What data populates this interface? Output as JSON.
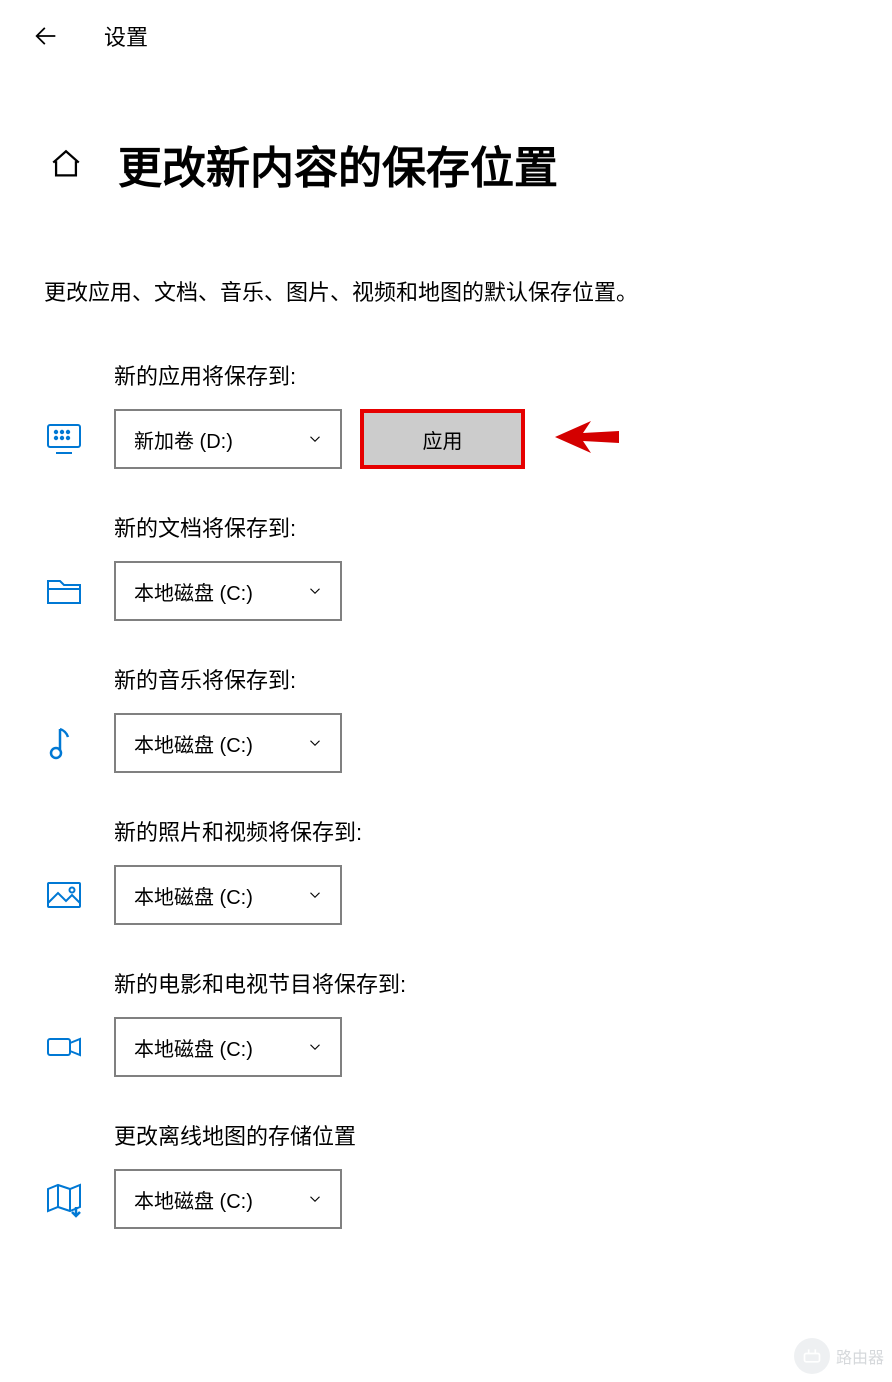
{
  "topbar": {
    "title": "设置"
  },
  "page": {
    "title": "更改新内容的保存位置",
    "description": "更改应用、文档、音乐、图片、视频和地图的默认保存位置。"
  },
  "settings": {
    "apps": {
      "label": "新的应用将保存到:",
      "value": "新加卷 (D:)",
      "apply": "应用",
      "icon": "keyboard-monitor-icon"
    },
    "documents": {
      "label": "新的文档将保存到:",
      "value": "本地磁盘 (C:)",
      "icon": "folder-icon"
    },
    "music": {
      "label": "新的音乐将保存到:",
      "value": "本地磁盘 (C:)",
      "icon": "music-note-icon"
    },
    "photos": {
      "label": "新的照片和视频将保存到:",
      "value": "本地磁盘 (C:)",
      "icon": "picture-icon"
    },
    "movies": {
      "label": "新的电影和电视节目将保存到:",
      "value": "本地磁盘 (C:)",
      "icon": "video-camera-icon"
    },
    "maps": {
      "label": "更改离线地图的存储位置",
      "value": "本地磁盘 (C:)",
      "icon": "map-icon"
    }
  },
  "colors": {
    "accent": "#0078d4",
    "highlight_border": "#e60000",
    "button_bg": "#cccccc",
    "border": "#808080"
  },
  "watermark": {
    "text": "路由器"
  }
}
